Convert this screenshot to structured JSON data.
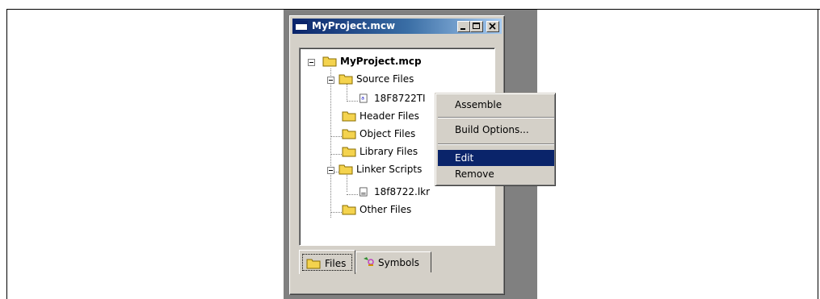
{
  "window": {
    "title": "MyProject.mcw",
    "controls": [
      "minimize",
      "maximize",
      "close"
    ]
  },
  "tree": {
    "root": "MyProject.mcp",
    "nodes": [
      {
        "label": "Source Files",
        "icon": "folder-icon",
        "expanded": true
      },
      {
        "label": "18F8722TI",
        "icon": "asm-file-icon"
      },
      {
        "label": "Header Files",
        "icon": "folder-icon"
      },
      {
        "label": "Object Files",
        "icon": "folder-icon"
      },
      {
        "label": "Library Files",
        "icon": "folder-icon"
      },
      {
        "label": "Linker Scripts",
        "icon": "folder-icon",
        "expanded": true
      },
      {
        "label": "18f8722.lkr",
        "icon": "text-file-icon"
      },
      {
        "label": "Other Files",
        "icon": "folder-icon"
      }
    ]
  },
  "tabs": [
    {
      "label": "Files",
      "icon": "folder-icon",
      "active": true
    },
    {
      "label": "Symbols",
      "icon": "symbols-icon",
      "active": false
    }
  ],
  "context_menu": {
    "items": [
      {
        "label": "Assemble"
      },
      {
        "label": "Build Options..."
      },
      {
        "label": "Edit",
        "selected": true
      },
      {
        "label": "Remove"
      }
    ]
  },
  "colors": {
    "title_active": "#0a246a",
    "menu_highlight": "#0a246a",
    "face": "#d4d0c8",
    "backdrop": "#808080"
  }
}
